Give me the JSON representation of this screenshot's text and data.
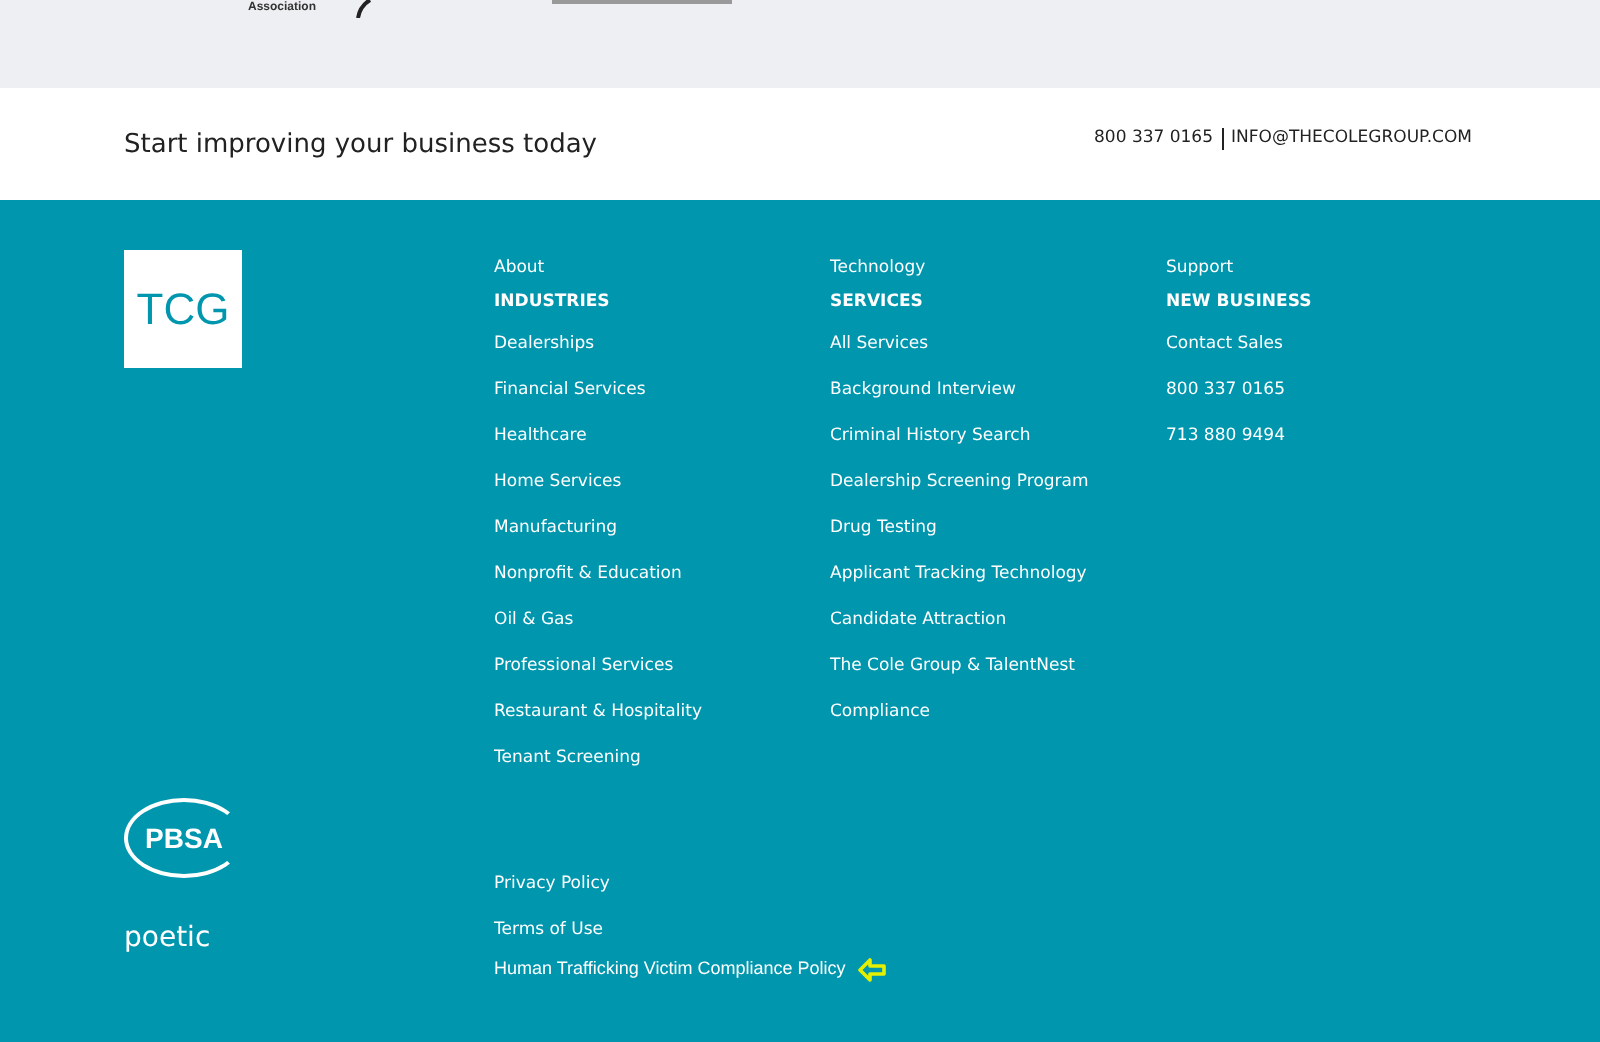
{
  "partner_strip": {
    "logo_caption": "Association"
  },
  "cta_bar": {
    "headline": "Start improving your business today",
    "phone": "800 337 0165",
    "email": "INFO@THECOLEGROUP.COM"
  },
  "footer": {
    "logo": "TCG",
    "columns": [
      {
        "top_link": "About",
        "heading": "INDUSTRIES",
        "links": [
          "Dealerships",
          "Financial Services",
          "Healthcare",
          "Home Services",
          "Manufacturing",
          "Nonprofit & Education",
          "Oil & Gas",
          "Professional Services",
          "Restaurant & Hospitality",
          "Tenant Screening"
        ]
      },
      {
        "top_link": "Technology",
        "heading": "SERVICES",
        "links": [
          "All Services",
          "Background Interview",
          "Criminal History Search",
          "Dealership Screening Program",
          "Drug Testing",
          "Applicant Tracking Technology",
          "Candidate Attraction",
          "The Cole Group & TalentNest",
          "Compliance"
        ]
      },
      {
        "top_link": "Support",
        "heading": "NEW BUSINESS",
        "links": [
          "Contact Sales",
          "800 337 0165",
          "713 880 9494"
        ]
      }
    ],
    "badge_logo": "PBSA",
    "agency_logo": "poetic",
    "legal_links": [
      "Privacy Policy",
      "Terms of Use",
      "Human Trafficking Victim Compliance Policy"
    ]
  }
}
